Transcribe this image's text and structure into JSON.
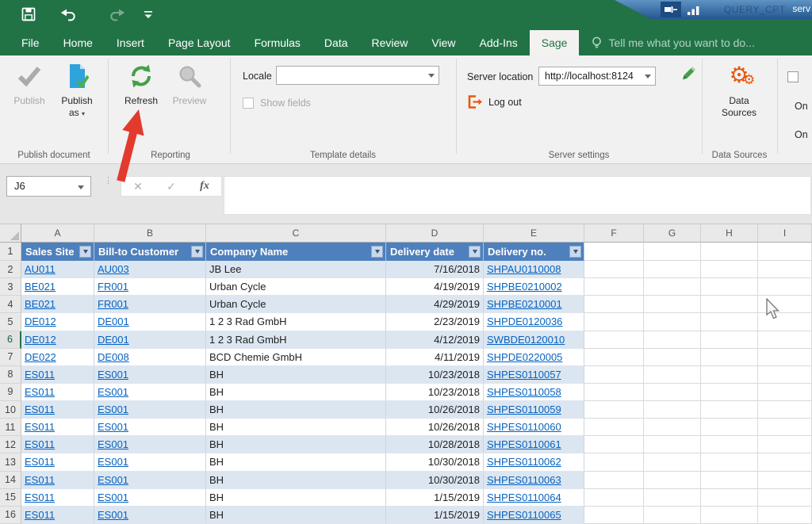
{
  "titlebar": {
    "rdp_machine": "QUERY_CPT",
    "rdp_right": "serv"
  },
  "tabs": [
    {
      "label": "File"
    },
    {
      "label": "Home"
    },
    {
      "label": "Insert"
    },
    {
      "label": "Page Layout"
    },
    {
      "label": "Formulas"
    },
    {
      "label": "Data"
    },
    {
      "label": "Review"
    },
    {
      "label": "View"
    },
    {
      "label": "Add-Ins"
    },
    {
      "label": "Sage",
      "active": true
    },
    {
      "label": "Tell me what you want to do...",
      "tellme": true
    }
  ],
  "ribbon": {
    "publish_document": {
      "group_label": "Publish document",
      "publish_label": "Publish",
      "publish_as_line1": "Publish",
      "publish_as_line2": "as"
    },
    "reporting": {
      "group_label": "Reporting",
      "refresh_label": "Refresh",
      "preview_label": "Preview"
    },
    "template_details": {
      "group_label": "Template details",
      "locale_label": "Locale",
      "locale_value": "",
      "show_fields_label": "Show fields"
    },
    "server_settings": {
      "group_label": "Server settings",
      "server_location_label": "Server location",
      "server_url": "http://localhost:8124",
      "logout_label": "Log out"
    },
    "data_sources": {
      "group_label": "Data Sources",
      "button_line1": "Data",
      "button_line2": "Sources"
    },
    "partial_right": {
      "on1": "On",
      "on2": "On"
    }
  },
  "formula_bar": {
    "name_box": "J6",
    "fx": "fx",
    "cancel": "✕",
    "enter": "✓"
  },
  "grid": {
    "column_letters": [
      "A",
      "B",
      "C",
      "D",
      "E",
      "F",
      "G",
      "H",
      "I"
    ],
    "active_row": 6,
    "table_headers": [
      "Sales Site",
      "Bill-to Customer",
      "Company Name",
      "Delivery date",
      "Delivery no."
    ],
    "rows": [
      {
        "n": 2,
        "sales_site": "AU011",
        "bill_to": "AU003",
        "company": "JB Lee",
        "date": "7/16/2018",
        "delivery_no": "SHPAU0110008"
      },
      {
        "n": 3,
        "sales_site": "BE021",
        "bill_to": "FR001",
        "company": "Urban Cycle",
        "date": "4/19/2019",
        "delivery_no": "SHPBE0210002"
      },
      {
        "n": 4,
        "sales_site": "BE021",
        "bill_to": "FR001",
        "company": "Urban Cycle",
        "date": "4/29/2019",
        "delivery_no": "SHPBE0210001"
      },
      {
        "n": 5,
        "sales_site": "DE012",
        "bill_to": "DE001",
        "company": "1 2 3 Rad GmbH",
        "date": "2/23/2019",
        "delivery_no": "SHPDE0120036"
      },
      {
        "n": 6,
        "sales_site": "DE012",
        "bill_to": "DE001",
        "company": "1 2 3 Rad GmbH",
        "date": "4/12/2019",
        "delivery_no": "SWBDE0120010"
      },
      {
        "n": 7,
        "sales_site": "DE022",
        "bill_to": "DE008",
        "company": "BCD Chemie GmbH",
        "date": "4/11/2019",
        "delivery_no": "SHPDE0220005"
      },
      {
        "n": 8,
        "sales_site": "ES011",
        "bill_to": "ES001",
        "company": "BH",
        "date": "10/23/2018",
        "delivery_no": "SHPES0110057"
      },
      {
        "n": 9,
        "sales_site": "ES011",
        "bill_to": "ES001",
        "company": "BH",
        "date": "10/23/2018",
        "delivery_no": "SHPES0110058"
      },
      {
        "n": 10,
        "sales_site": "ES011",
        "bill_to": "ES001",
        "company": "BH",
        "date": "10/26/2018",
        "delivery_no": "SHPES0110059"
      },
      {
        "n": 11,
        "sales_site": "ES011",
        "bill_to": "ES001",
        "company": "BH",
        "date": "10/26/2018",
        "delivery_no": "SHPES0110060"
      },
      {
        "n": 12,
        "sales_site": "ES011",
        "bill_to": "ES001",
        "company": "BH",
        "date": "10/28/2018",
        "delivery_no": "SHPES0110061"
      },
      {
        "n": 13,
        "sales_site": "ES011",
        "bill_to": "ES001",
        "company": "BH",
        "date": "10/30/2018",
        "delivery_no": "SHPES0110062"
      },
      {
        "n": 14,
        "sales_site": "ES011",
        "bill_to": "ES001",
        "company": "BH",
        "date": "10/30/2018",
        "delivery_no": "SHPES0110063"
      },
      {
        "n": 15,
        "sales_site": "ES011",
        "bill_to": "ES001",
        "company": "BH",
        "date": "1/15/2019",
        "delivery_no": "SHPES0110064"
      },
      {
        "n": 16,
        "sales_site": "ES011",
        "bill_to": "ES001",
        "company": "BH",
        "date": "1/15/2019",
        "delivery_no": "SHPES0110065"
      }
    ]
  },
  "colors": {
    "excel_green": "#217346",
    "table_header_blue": "#4e80bd",
    "banded_row_blue": "#dce6f1",
    "hyperlink_blue": "#0563c1",
    "accent_orange": "#e8590c",
    "refresh_green": "#43a047",
    "annotation_red": "#e23b2e"
  }
}
